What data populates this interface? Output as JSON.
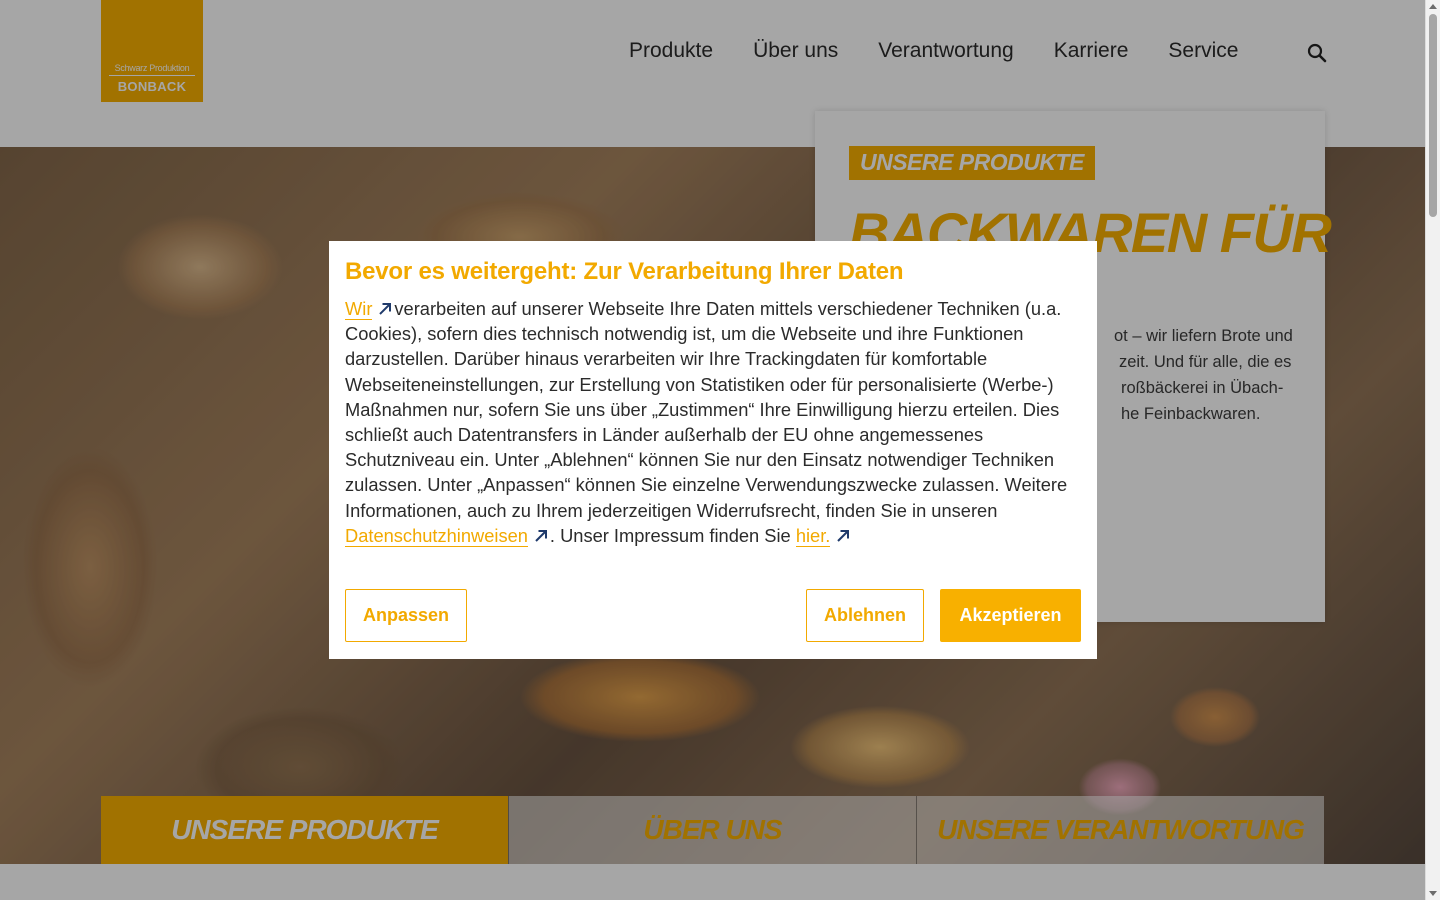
{
  "brand": {
    "logo_top": "Schwarz Produktion",
    "logo_bottom": "BONBACK",
    "color": "#f8b000"
  },
  "nav": {
    "items": [
      "Produkte",
      "Über uns",
      "Verantwortung",
      "Karriere",
      "Service"
    ],
    "search_icon": "search-icon"
  },
  "intro": {
    "tag": "UNSERE PRODUKTE",
    "heading": "BACKWAREN FÜR",
    "text_lines": [
      "ot – wir liefern Brote und",
      "zeit. Und für alle, die es",
      "roßbäckerei in Übach-",
      "he Feinbackwaren."
    ]
  },
  "tabs": {
    "items": [
      "UNSERE PRODUKTE",
      "ÜBER UNS",
      "UNSERE VERANTWORTUNG"
    ],
    "active_index": 0
  },
  "consent": {
    "title": "Bevor es weitergeht: Zur Verarbeitung Ihrer Daten",
    "link_we": "Wir",
    "text_1": "verarbeiten auf unserer Webseite Ihre Daten mittels verschiedener Techniken (u.a. Cookies), sofern dies technisch notwendig ist, um die Webseite und ihre Funktionen darzustellen. Darüber hinaus verarbeiten wir Ihre Trackingdaten für komfortable Webseiteneinstellungen, zur Erstellung von Statistiken oder für personalisierte (Werbe-) Maßnahmen nur, sofern Sie uns über „Zustimmen“ Ihre Einwilligung hierzu erteilen. Dies schließt auch Datentransfers in Länder außerhalb der EU ohne angemessenes Schutzniveau ein. Unter „Ablehnen“ können Sie nur den Einsatz notwendiger Techniken zulassen. Unter „Anpassen“ können Sie einzelne Verwendungszwecke zulassen. Weitere Informationen, auch zu Ihrem jederzeitigen Widerrufsrecht, finden Sie in unseren",
    "link_privacy": "Datenschutzhinweisen",
    "text_2": ". Unser Impressum finden Sie",
    "link_imprint": "hier.",
    "buttons": {
      "customize": "Anpassen",
      "decline": "Ablehnen",
      "accept": "Akzeptieren"
    },
    "accent": "#f2a900"
  }
}
